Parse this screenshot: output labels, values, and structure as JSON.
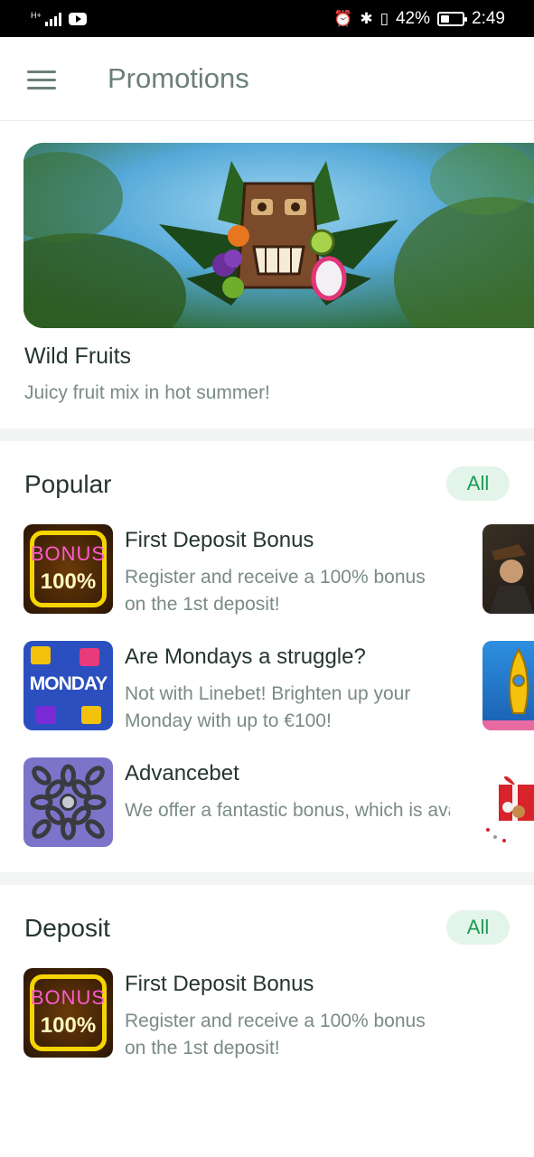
{
  "status_bar": {
    "network": "H+",
    "battery": "42%",
    "battery_level": 0.42,
    "time": "2:49"
  },
  "app_bar": {
    "title": "Promotions"
  },
  "banner": {
    "title": "Wild Fruits",
    "subtitle": "Juicy fruit mix in hot summer!"
  },
  "popular": {
    "title": "Popular",
    "all_label": "All",
    "items": [
      {
        "title": "First Deposit Bonus",
        "description": "Register and receive a 100% bonus on the 1st deposit!",
        "thumb_word": "BONUS",
        "thumb_value": "100%"
      },
      {
        "title": "Are Mondays a struggle?",
        "description": "Not with Linebet! Brighten up your Monday with up to €100!",
        "thumb_word": "MONDAY"
      },
      {
        "title": "Advancebet",
        "description": "We offer a fantastic bonus, which is available to customers …"
      }
    ]
  },
  "deposit": {
    "title": "Deposit",
    "all_label": "All",
    "items": [
      {
        "title": "First Deposit Bonus",
        "description": "Register and receive a 100% bonus on the 1st deposit!",
        "thumb_word": "BONUS",
        "thumb_value": "100%"
      }
    ]
  },
  "colors": {
    "accent": "#1f9a53",
    "accent_bg": "#e3f4ea",
    "title_text": "#253531",
    "muted_text": "#7a8b86"
  }
}
